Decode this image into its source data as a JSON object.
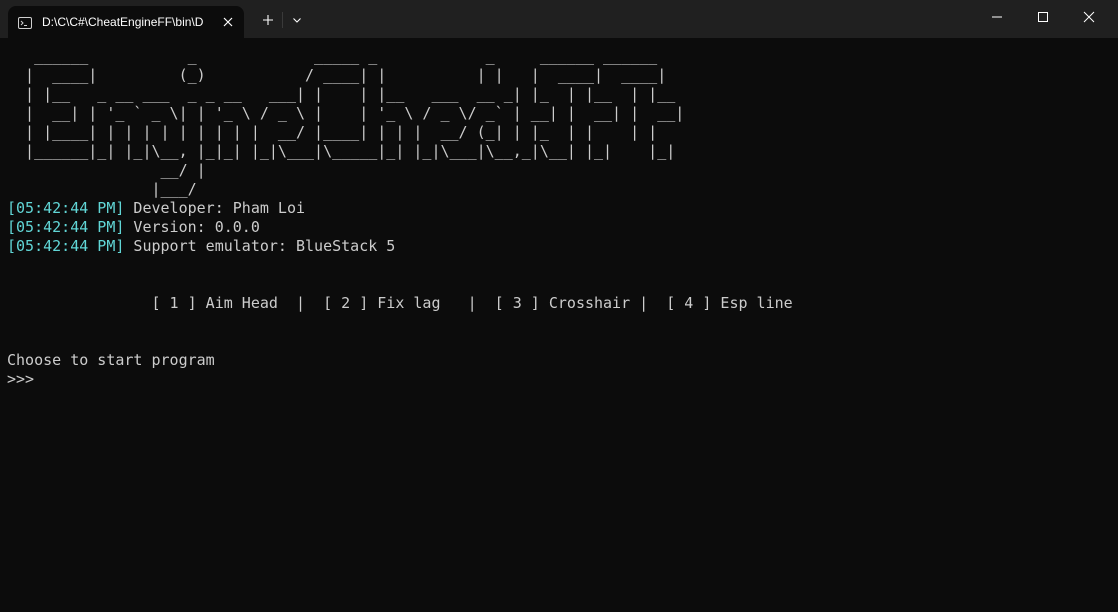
{
  "window": {
    "tab_title": "D:\\C\\C#\\CheatEngineFF\\bin\\D",
    "tab_icon": "console-icon",
    "new_tab_icon": "plus-icon",
    "dropdown_icon": "chevron-down-icon",
    "minimize_icon": "minimize-icon",
    "maximize_icon": "maximize-icon",
    "close_icon": "close-icon"
  },
  "console": {
    "banner": [
      "   ______           _             _____ _            _     ______ ______ ",
      "  |  ____|         (_)           / ____| |          | |   |  ____|  ____|",
      "  | |__   _ __ ___  _ _ __   ___| |    | |__   ___  __ _| |_  | |__  | |__   ",
      "  |  __| | '_ ` _ \\| | '_ \\ / _ \\ |    | '_ \\ / _ \\/ _` | __| |  __| |  __|  ",
      "  | |____| | | | | | | | | |  __/ |____| | | |  __/ (_| | |_  | |    | |     ",
      "  |______|_| |_|\\__, |_|_| |_|\\___|\\_____|_| |_|\\___|\\__,_|\\__| |_|    |_|     ",
      "                 __/ |                                                     ",
      "                |___/                                                      "
    ],
    "log": [
      {
        "time": "[05:42:44 PM]",
        "message": " Developer: Pham Loi"
      },
      {
        "time": "[05:42:44 PM]",
        "message": " Version: 0.0.0"
      },
      {
        "time": "[05:42:44 PM]",
        "message": " Support emulator: BlueStack 5"
      }
    ],
    "menu": "                [ 1 ] Aim Head  |  [ 2 ] Fix lag   |  [ 3 ] Crosshair |  [ 4 ] Esp line",
    "prompt_text": "Choose to start program",
    "input_prompt": ">>>"
  },
  "colors": {
    "background": "#0c0c0c",
    "titlebar": "#202020",
    "text": "#cccccc",
    "timestamp": "#61d6d6"
  }
}
